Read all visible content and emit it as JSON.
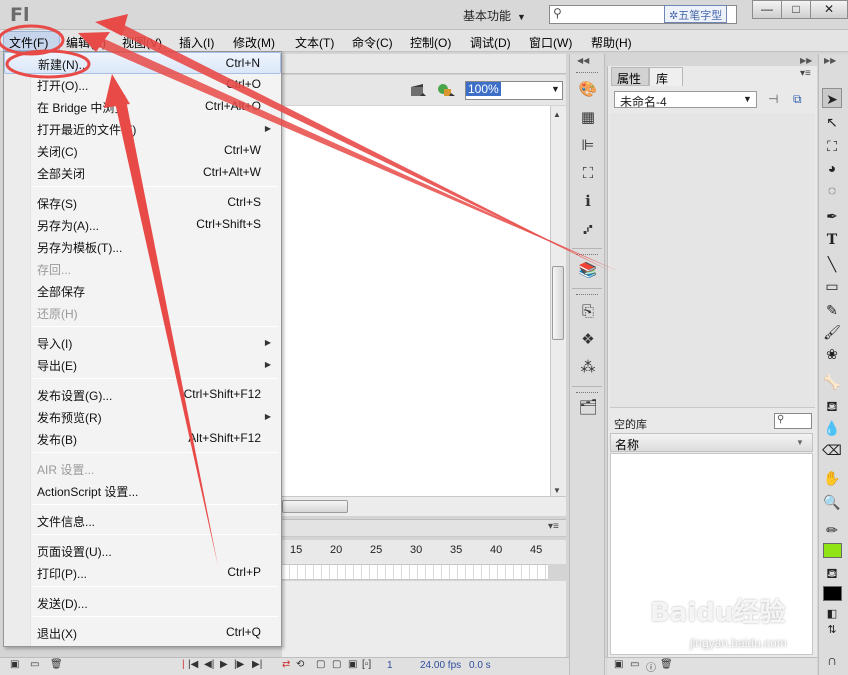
{
  "app": {
    "logo": "Fl",
    "workspace": "基本功能",
    "watermark_tag": "五笔字型"
  },
  "window_buttons": {
    "minimize": "—",
    "maximize": "□",
    "close": "✕"
  },
  "menubar": [
    "文件(F)",
    "编辑(E)",
    "视图(V)",
    "插入(I)",
    "修改(M)",
    "文本(T)",
    "命令(C)",
    "控制(O)",
    "调试(D)",
    "窗口(W)",
    "帮助(H)"
  ],
  "file_menu": [
    {
      "label": "新建(N)...",
      "shortcut": "Ctrl+N",
      "highlighted": true
    },
    {
      "label": "打开(O)...",
      "shortcut": "Ctrl+O"
    },
    {
      "label": "在 Bridge 中浏览",
      "shortcut": "Ctrl+Alt+O"
    },
    {
      "label": "打开最近的文件(F)",
      "submenu": true
    },
    {
      "label": "关闭(C)",
      "shortcut": "Ctrl+W"
    },
    {
      "label": "全部关闭",
      "shortcut": "Ctrl+Alt+W"
    },
    {
      "label": "保存(S)",
      "shortcut": "Ctrl+S"
    },
    {
      "label": "另存为(A)...",
      "shortcut": "Ctrl+Shift+S"
    },
    {
      "label": "另存为模板(T)..."
    },
    {
      "label": "存回...",
      "disabled": true
    },
    {
      "label": "全部保存"
    },
    {
      "label": "还原(H)",
      "disabled": true
    },
    {
      "label": "导入(I)",
      "submenu": true
    },
    {
      "label": "导出(E)",
      "submenu": true
    },
    {
      "label": "发布设置(G)...",
      "shortcut": "Ctrl+Shift+F12"
    },
    {
      "label": "发布预览(R)",
      "submenu": true
    },
    {
      "label": "发布(B)",
      "shortcut": "Alt+Shift+F12"
    },
    {
      "label": "AIR 设置...",
      "disabled": true
    },
    {
      "label": "ActionScript 设置..."
    },
    {
      "label": "文件信息..."
    },
    {
      "label": "页面设置(U)..."
    },
    {
      "label": "打印(P)...",
      "shortcut": "Ctrl+P"
    },
    {
      "label": "发送(D)..."
    },
    {
      "label": "退出(X)",
      "shortcut": "Ctrl+Q"
    }
  ],
  "stage": {
    "zoom": "100%"
  },
  "timeline": {
    "frame_numbers": [
      "15",
      "20",
      "25",
      "30",
      "35",
      "40",
      "45"
    ],
    "current_frame": "1",
    "fps": "24.00 fps",
    "time": "0.0 s",
    "fps_label": "fps"
  },
  "library": {
    "tab_properties": "属性",
    "tab_library": "库",
    "document": "未命名-4",
    "empty_label": "空的库",
    "column_name": "名称"
  },
  "watermark": {
    "logo": "Baidu经验",
    "url": "jingyan.baidu.com"
  },
  "colors": {
    "stroke": "#90e414",
    "fill": "#000000",
    "arrow": "#e84a48",
    "selection": "#3d6fc9"
  }
}
